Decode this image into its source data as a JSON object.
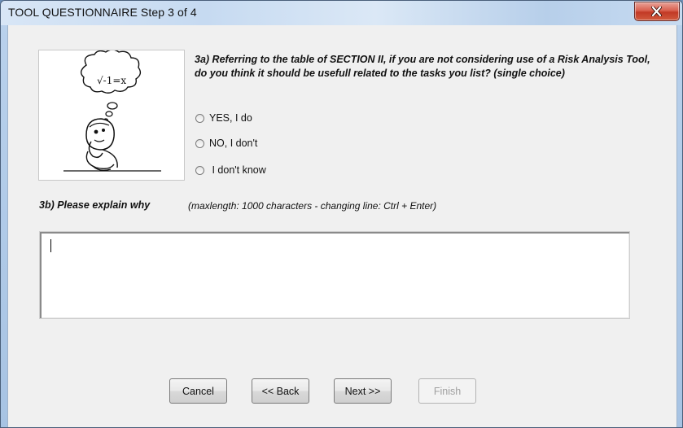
{
  "window": {
    "title": "TOOL QUESTIONNAIRE Step 3 of 4",
    "close_icon": "close-icon"
  },
  "illustration": {
    "thought_text": "√-1=x",
    "icon": "thinking-cartoon-icon"
  },
  "question_3a": {
    "text": "3a) Referring to the table of SECTION II, if you are not considering use of a Risk Analysis Tool,  do you think it should be usefull related to the tasks you list? (single choice)",
    "options": [
      {
        "label": "YES, I do",
        "selected": false
      },
      {
        "label": "NO, I don't",
        "selected": false
      },
      {
        "label": " I don't know",
        "selected": false
      }
    ]
  },
  "question_3b": {
    "label": "3b) Please explain why",
    "hint": "(maxlength: 1000 characters - changing line: Ctrl + Enter)",
    "value": ""
  },
  "buttons": {
    "cancel": "Cancel",
    "back": "<< Back",
    "next": "Next >>",
    "finish": "Finish"
  }
}
